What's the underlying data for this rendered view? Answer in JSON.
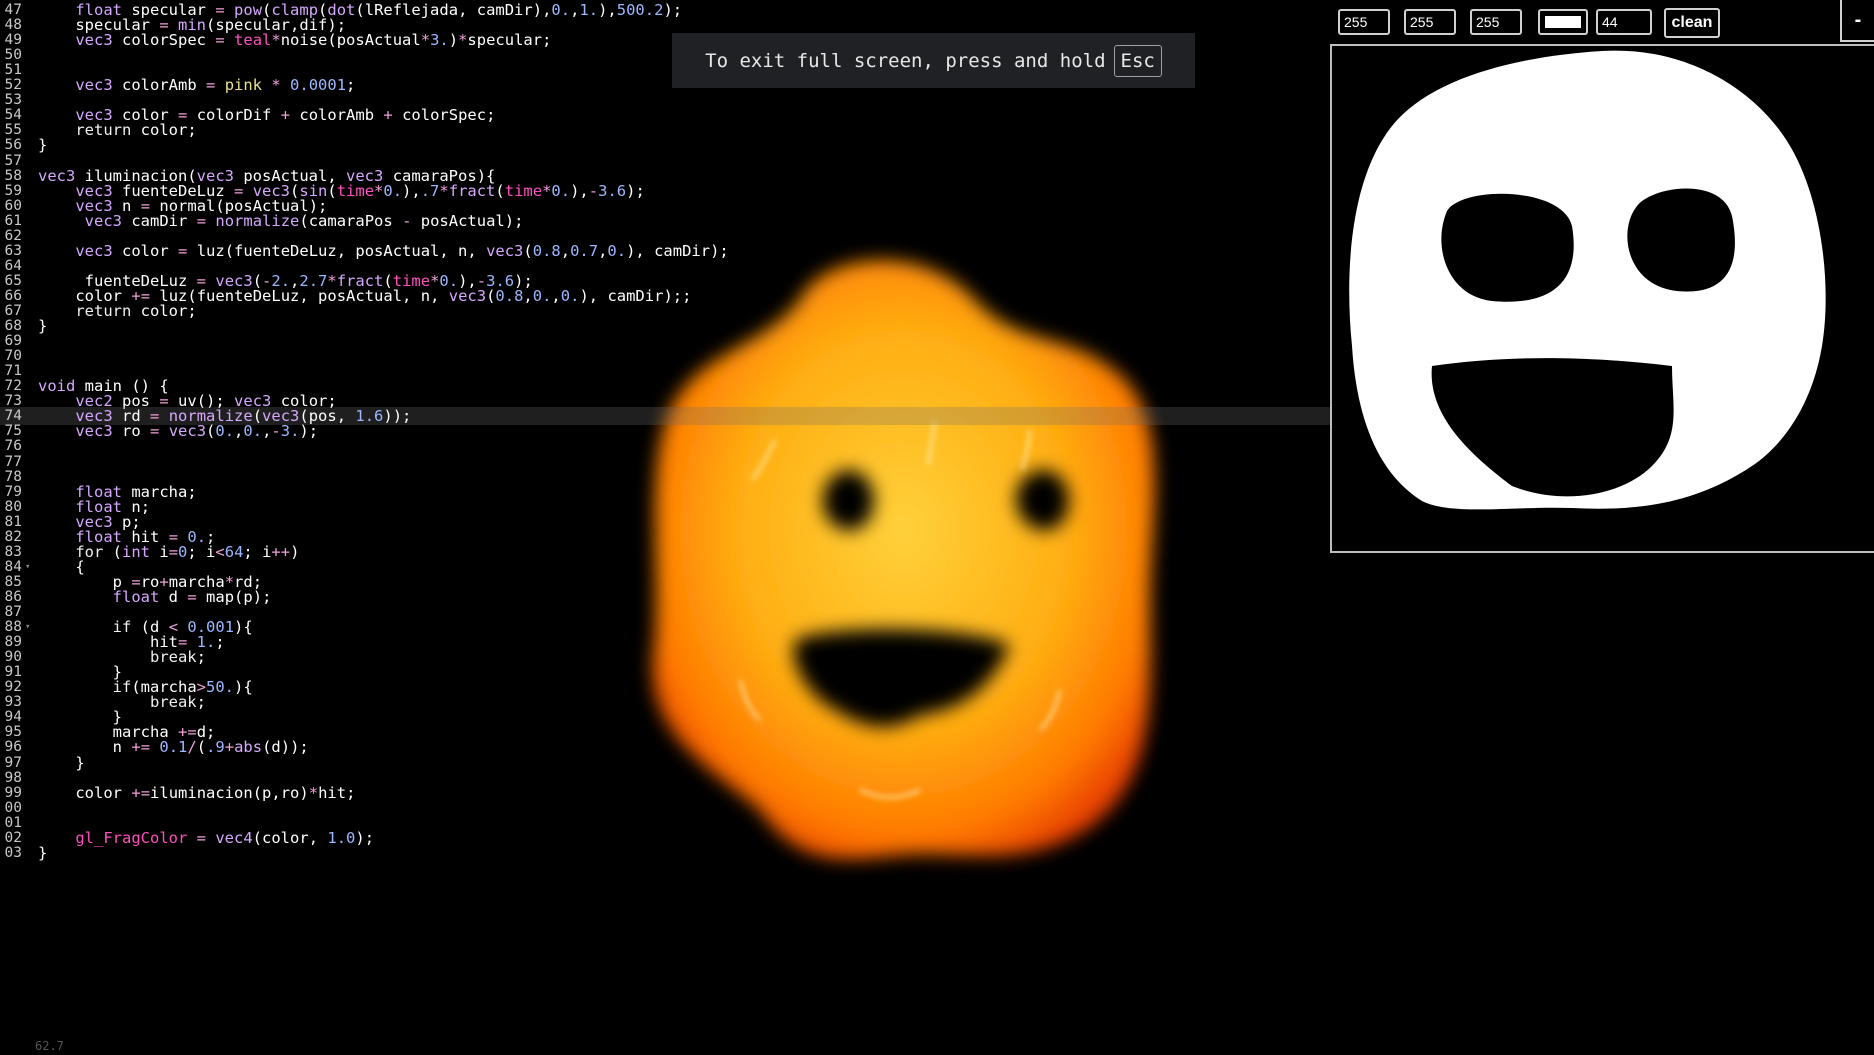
{
  "toast": {
    "text": "To exit full screen, press and hold",
    "key": "Esc"
  },
  "panel": {
    "red": "255",
    "green": "255",
    "blue": "255",
    "color": "#ffffff",
    "brush_size": "44",
    "clean_label": "clean",
    "collapse_label": "-"
  },
  "fps": "62.7",
  "editor": {
    "active_line": "74",
    "lines": [
      {
        "n": "47",
        "t": "    float specular = pow(clamp(dot(lReflejada, camDir),0.,1.),500.2);"
      },
      {
        "n": "48",
        "t": "    specular = min(specular,dif);"
      },
      {
        "n": "49",
        "t": "    vec3 colorSpec = teal*noise(posActual*3.)*specular;"
      },
      {
        "n": "50",
        "t": ""
      },
      {
        "n": "51",
        "t": ""
      },
      {
        "n": "52",
        "t": "    vec3 colorAmb = pink * 0.0001;"
      },
      {
        "n": "53",
        "t": ""
      },
      {
        "n": "54",
        "t": "    vec3 color = colorDif + colorAmb + colorSpec;"
      },
      {
        "n": "55",
        "t": "    return color;"
      },
      {
        "n": "56",
        "t": "}"
      },
      {
        "n": "57",
        "t": ""
      },
      {
        "n": "58",
        "t": "vec3 iluminacion(vec3 posActual, vec3 camaraPos){"
      },
      {
        "n": "59",
        "t": "    vec3 fuenteDeLuz = vec3(sin(time*0.),.7*fract(time*0.),-3.6);"
      },
      {
        "n": "60",
        "t": "    vec3 n = normal(posActual);"
      },
      {
        "n": "61",
        "t": "     vec3 camDir = normalize(camaraPos - posActual);"
      },
      {
        "n": "62",
        "t": ""
      },
      {
        "n": "63",
        "t": "    vec3 color = luz(fuenteDeLuz, posActual, n, vec3(0.8,0.7,0.), camDir);"
      },
      {
        "n": "64",
        "t": ""
      },
      {
        "n": "65",
        "t": "     fuenteDeLuz = vec3(-2.,2.7*fract(time*0.),-3.6);"
      },
      {
        "n": "66",
        "t": "    color += luz(fuenteDeLuz, posActual, n, vec3(0.8,0.,0.), camDir);;"
      },
      {
        "n": "67",
        "t": "    return color;"
      },
      {
        "n": "68",
        "t": "}"
      },
      {
        "n": "69",
        "t": ""
      },
      {
        "n": "70",
        "t": ""
      },
      {
        "n": "71",
        "t": ""
      },
      {
        "n": "72",
        "t": "void main () {"
      },
      {
        "n": "73",
        "t": "    vec2 pos = uv(); vec3 color;"
      },
      {
        "n": "74",
        "t": "    vec3 rd = normalize(vec3(pos, 1.6));"
      },
      {
        "n": "75",
        "t": "    vec3 ro = vec3(0.,0.,-3.);"
      },
      {
        "n": "76",
        "t": ""
      },
      {
        "n": "77",
        "t": ""
      },
      {
        "n": "78",
        "t": ""
      },
      {
        "n": "79",
        "t": "    float marcha;"
      },
      {
        "n": "80",
        "t": "    float n;"
      },
      {
        "n": "81",
        "t": "    vec3 p;"
      },
      {
        "n": "82",
        "t": "    float hit = 0.;"
      },
      {
        "n": "83",
        "t": "    for (int i=0; i<64; i++)"
      },
      {
        "n": "84",
        "t": "    {"
      },
      {
        "n": "85",
        "t": "        p =ro+marcha*rd;"
      },
      {
        "n": "86",
        "t": "        float d = map(p);"
      },
      {
        "n": "87",
        "t": ""
      },
      {
        "n": "88",
        "t": "        if (d < 0.001){"
      },
      {
        "n": "89",
        "t": "            hit= 1.;"
      },
      {
        "n": "90",
        "t": "            break;"
      },
      {
        "n": "91",
        "t": "        }"
      },
      {
        "n": "92",
        "t": "        if(marcha>50.){"
      },
      {
        "n": "93",
        "t": "            break;"
      },
      {
        "n": "94",
        "t": "        }"
      },
      {
        "n": "95",
        "t": "        marcha +=d;"
      },
      {
        "n": "96",
        "t": "        n += 0.1/(.9+abs(d));"
      },
      {
        "n": "97",
        "t": "    }"
      },
      {
        "n": "98",
        "t": ""
      },
      {
        "n": "99",
        "t": "    color +=iluminacion(p,ro)*hit;"
      },
      {
        "n": "00",
        "t": ""
      },
      {
        "n": "01",
        "t": ""
      },
      {
        "n": "02",
        "t": "    gl_FragColor = vec4(color, 1.0);"
      },
      {
        "n": "03",
        "t": "}"
      }
    ]
  }
}
